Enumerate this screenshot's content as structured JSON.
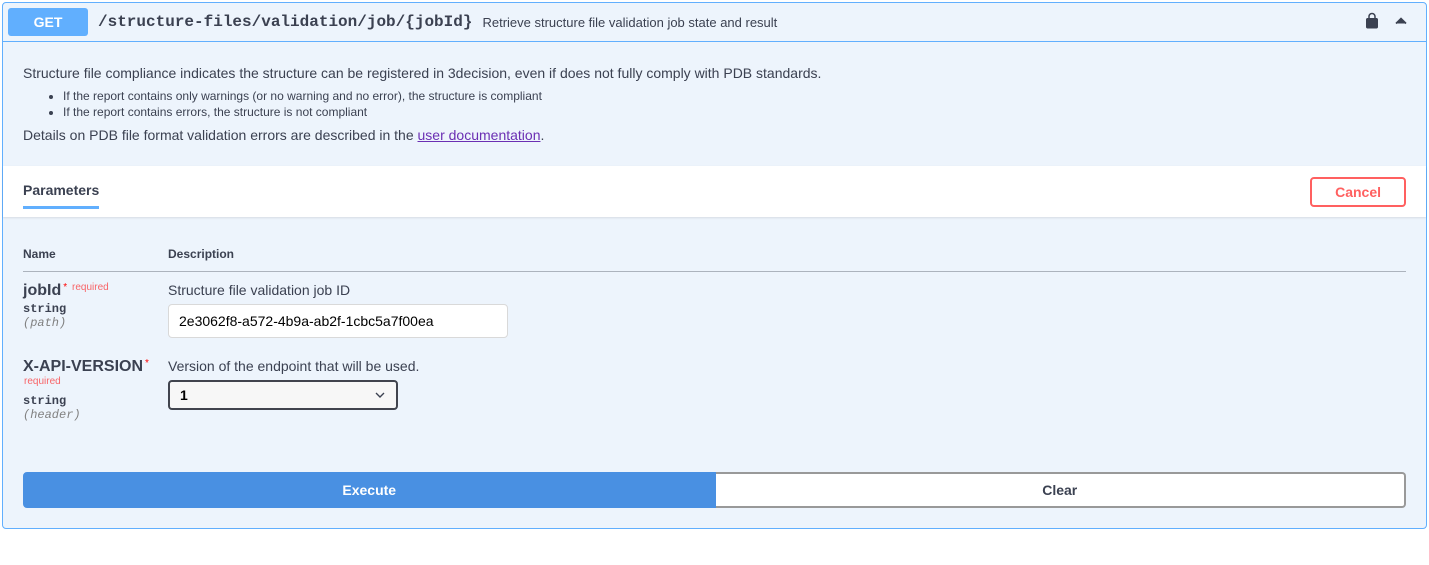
{
  "summary": {
    "method": "GET",
    "path": "/structure-files/validation/job/{jobId}",
    "description": "Retrieve structure file validation job state and result"
  },
  "description": {
    "intro": "Structure file compliance indicates the structure can be registered in 3decision, even if does not fully comply with PDB standards.",
    "bullets": [
      "If the report contains only warnings (or no warning and no error), the structure is compliant",
      "If the report contains errors, the structure is not compliant"
    ],
    "details_prefix": "Details on PDB file format validation errors are described in the ",
    "details_link": "user documentation",
    "details_suffix": "."
  },
  "section": {
    "tab_label": "Parameters",
    "cancel_label": "Cancel"
  },
  "table": {
    "col_name": "Name",
    "col_desc": "Description"
  },
  "required_star": "*",
  "required_text": "required",
  "params": [
    {
      "name": "jobId",
      "type": "string",
      "in": "(path)",
      "desc": "Structure file validation job ID",
      "input_type": "text",
      "value": "2e3062f8-a572-4b9a-ab2f-1cbc5a7f00ea"
    },
    {
      "name": "X-API-VERSION",
      "type": "string",
      "in": "(header)",
      "desc": "Version of the endpoint that will be used.",
      "input_type": "select",
      "value": "1"
    }
  ],
  "actions": {
    "execute": "Execute",
    "clear": "Clear"
  }
}
